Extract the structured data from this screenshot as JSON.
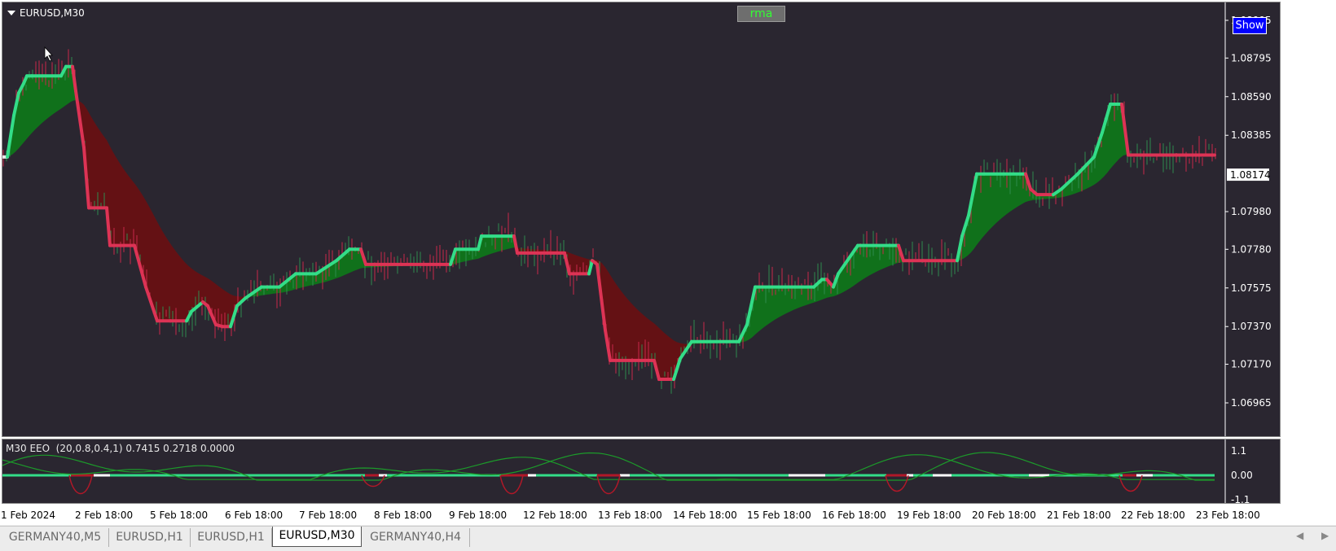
{
  "chart": {
    "symbol": "EURUSD,M30",
    "rma_button": "rma",
    "show_button": "Show",
    "current_price": "1.08174",
    "price_ticks": [
      "1.08995",
      "1.08795",
      "1.08590",
      "1.08385",
      "1.07980",
      "1.07780",
      "1.07575",
      "1.07370",
      "1.07170",
      "1.06965"
    ],
    "time_labels": [
      "1 Feb 2024",
      "2 Feb 18:00",
      "5 Feb 18:00",
      "6 Feb 18:00",
      "7 Feb 18:00",
      "8 Feb 18:00",
      "9 Feb 18:00",
      "12 Feb 18:00",
      "13 Feb 18:00",
      "14 Feb 18:00",
      "15 Feb 18:00",
      "16 Feb 18:00",
      "19 Feb 18:00",
      "20 Feb 18:00",
      "21 Feb 18:00",
      "22 Feb 18:00",
      "23 Feb 18:00"
    ],
    "colors": {
      "bull": "#33dd88",
      "bear": "#dd3355",
      "neutral": "#e8e8e8",
      "cloud_green": "#0d7a1a",
      "cloud_red": "#6a0f12",
      "background": "#2a2630"
    }
  },
  "indicator": {
    "label": "M30 EEO  (20,0.8,0.4,1) 0.7415 0.2718 0.0000",
    "ticks": [
      "1.1",
      "0.00",
      "-1.1"
    ]
  },
  "tabs": [
    {
      "label": "GERMANY40,M5",
      "active": false
    },
    {
      "label": "EURUSD,H1",
      "active": false
    },
    {
      "label": "EURUSD,H1",
      "active": false
    },
    {
      "label": "EURUSD,M30",
      "active": true
    },
    {
      "label": "GERMANY40,H4",
      "active": false
    }
  ],
  "icons": {
    "left": "scroll-left-icon",
    "right": "scroll-right-icon"
  }
}
